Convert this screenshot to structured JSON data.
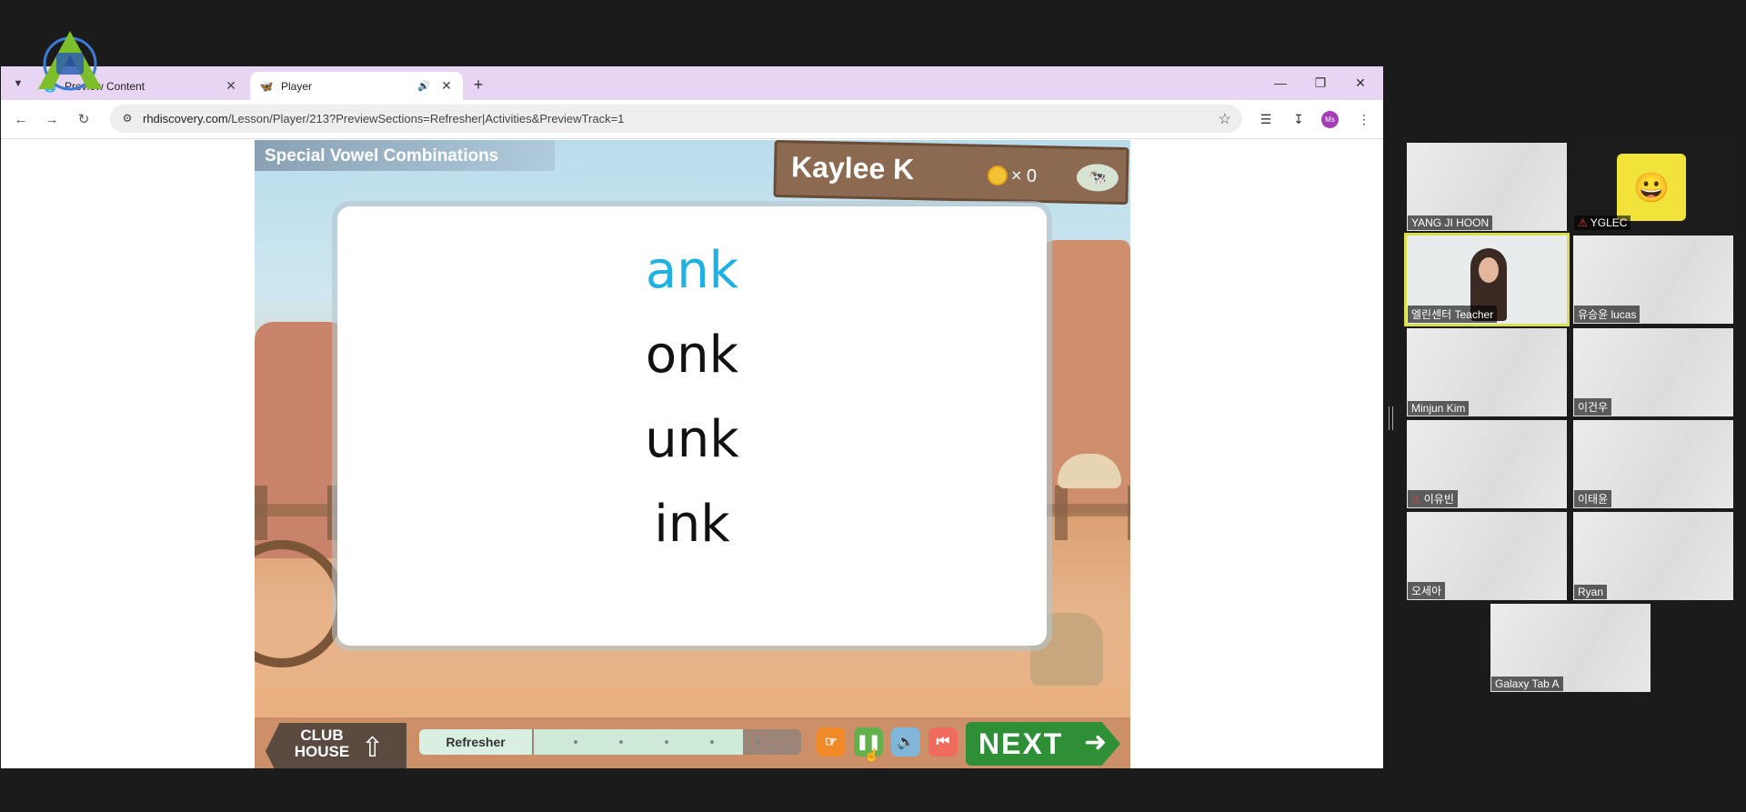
{
  "browser": {
    "tabs": [
      {
        "title": "Preview Content",
        "active": false
      },
      {
        "title": "Player",
        "active": true
      }
    ],
    "url_host": "rhdiscovery.com",
    "url_path": "/Lesson/Player/213?PreviewSections=Refresher|Activities&PreviewTrack=1",
    "profile_initials": "Ms",
    "icons": {
      "back": "arrow-left-icon",
      "forward": "arrow-right-icon",
      "reload": "reload-icon",
      "site_info": "tune-icon",
      "bookmark": "star-icon",
      "media": "media-control-icon",
      "download": "download-icon",
      "menu": "kebab-menu-icon"
    }
  },
  "lesson": {
    "title": "Special Vowel Combinations",
    "student_name": "Kaylee K",
    "coin_multiplier": "×",
    "coin_count": "0",
    "words": [
      {
        "text": "ank",
        "highlighted": true
      },
      {
        "text": "onk",
        "highlighted": false
      },
      {
        "text": "unk",
        "highlighted": false
      },
      {
        "text": "ink",
        "highlighted": false
      }
    ],
    "clubhouse_label": "CLUB HOUSE",
    "progress_label": "Refresher",
    "next_label": "NEXT",
    "colors": {
      "highlight": "#1fb1e2",
      "next": "#2f8f36",
      "progress_fill": "#cfe9d8"
    }
  },
  "participants": [
    {
      "name": "YANG JI HOON",
      "muted": false
    },
    {
      "name": "YGLEC",
      "muted": true
    },
    {
      "name": "엘린센터 Teacher",
      "muted": false,
      "speaking": true
    },
    {
      "name": "유승윤 lucas",
      "muted": false
    },
    {
      "name": "Minjun Kim",
      "muted": false
    },
    {
      "name": "이건우",
      "muted": false
    },
    {
      "name": "이유빈",
      "muted": true
    },
    {
      "name": "이태윤",
      "muted": false
    },
    {
      "name": "오세아",
      "muted": false
    },
    {
      "name": "Ryan",
      "muted": false
    },
    {
      "name": "Galaxy Tab A",
      "muted": false
    }
  ]
}
